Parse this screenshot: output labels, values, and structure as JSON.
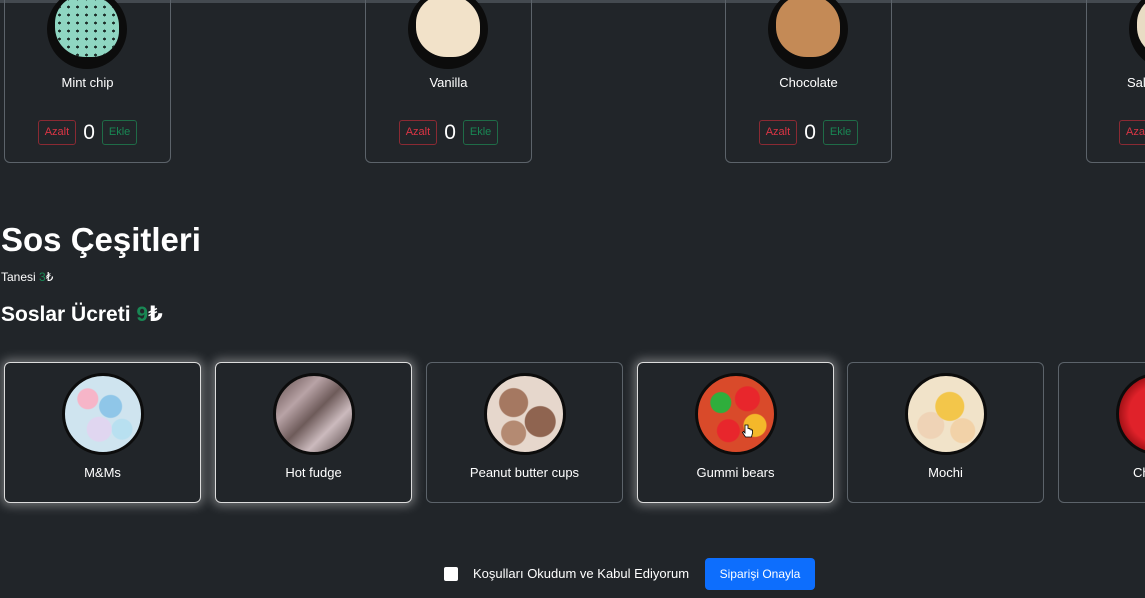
{
  "scoops": [
    {
      "name": "Mint chip",
      "decrease_label": "Azalt",
      "quantity": "0",
      "increase_label": "Ekle"
    },
    {
      "name": "Vanilla",
      "decrease_label": "Azalt",
      "quantity": "0",
      "increase_label": "Ekle"
    },
    {
      "name": "Chocolate",
      "decrease_label": "Azalt",
      "quantity": "0",
      "increase_label": "Ekle"
    },
    {
      "name": "Sal",
      "decrease_label": "Aza",
      "quantity": "",
      "increase_label": ""
    }
  ],
  "toppings_section": {
    "title": "Sos Çeşitleri",
    "unit_price_label": "Tanesi ",
    "unit_price_value": "3",
    "currency": "₺",
    "total_label": "Soslar Ücreti ",
    "total_value": "9"
  },
  "toppings": [
    {
      "name": "M&Ms",
      "selected": true
    },
    {
      "name": "Hot fudge",
      "selected": true
    },
    {
      "name": "Peanut butter cups",
      "selected": false
    },
    {
      "name": "Gummi bears",
      "selected": true
    },
    {
      "name": "Mochi",
      "selected": false
    },
    {
      "name": "Ch",
      "selected": false
    }
  ],
  "footer": {
    "terms_label": "Koşulları Okudum ve Kabul Ediyorum",
    "terms_checked": false,
    "confirm_label": "Siparişi Onayla"
  },
  "colors": {
    "background": "#212529",
    "decrease": "#dc3545",
    "increase": "#198754",
    "price": "#198754",
    "primary": "#0d6efd"
  }
}
